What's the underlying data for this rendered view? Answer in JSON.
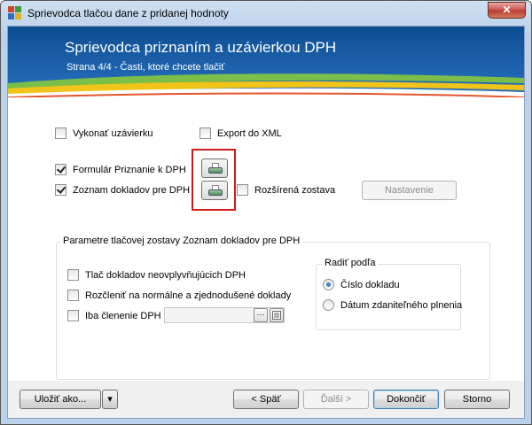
{
  "window": {
    "title": "Sprievodca tlačou dane z pridanej hodnoty",
    "close_glyph": "✕",
    "app_icon": "app-icon"
  },
  "banner": {
    "title": "Sprievodca priznaním a uzávierkou DPH",
    "subtitle": "Strana 4/4 - Časti, ktoré chcete tlačiť"
  },
  "options": {
    "vykonat_uzavierku": {
      "label": "Vykonať uzávierku",
      "checked": false
    },
    "export_xml": {
      "label": "Export do XML",
      "checked": false
    },
    "formular_priznanie": {
      "label": "Formulár Priznanie k DPH",
      "checked": true
    },
    "zoznam_dokladov": {
      "label": "Zoznam dokladov pre DPH",
      "checked": true
    },
    "rozsirena_zostava": {
      "label": "Rozšírená zostava",
      "checked": false
    },
    "nastavenie_label": "Nastavenie",
    "print_icon": "printer-icon"
  },
  "params_group": {
    "title": "Parametre tlačovej zostavy Zoznam dokladov pre DPH",
    "tlac_neovplyvnujucich": {
      "label": "Tlač dokladov neovplyvňujúcich DPH",
      "checked": false
    },
    "rozclenit": {
      "label": "Rozčleniť na normálne a zjednodušené doklady",
      "checked": false
    },
    "iba_clenenie": {
      "label": "Iba členenie DPH",
      "checked": false
    },
    "clenenie_value": "",
    "ellipsis_label": "···",
    "list_icon": "list-icon"
  },
  "sort_group": {
    "title": "Radiť podľa",
    "options": [
      {
        "label": "Číslo dokladu",
        "checked": true
      },
      {
        "label": "Dátum zdaniteľného plnenia",
        "checked": false
      }
    ]
  },
  "footer": {
    "save_as": "Uložiť ako...",
    "dropdown_glyph": "▾",
    "back": "< Späť",
    "next": "Ďalší >",
    "finish": "Dokončiť",
    "cancel": "Storno"
  }
}
